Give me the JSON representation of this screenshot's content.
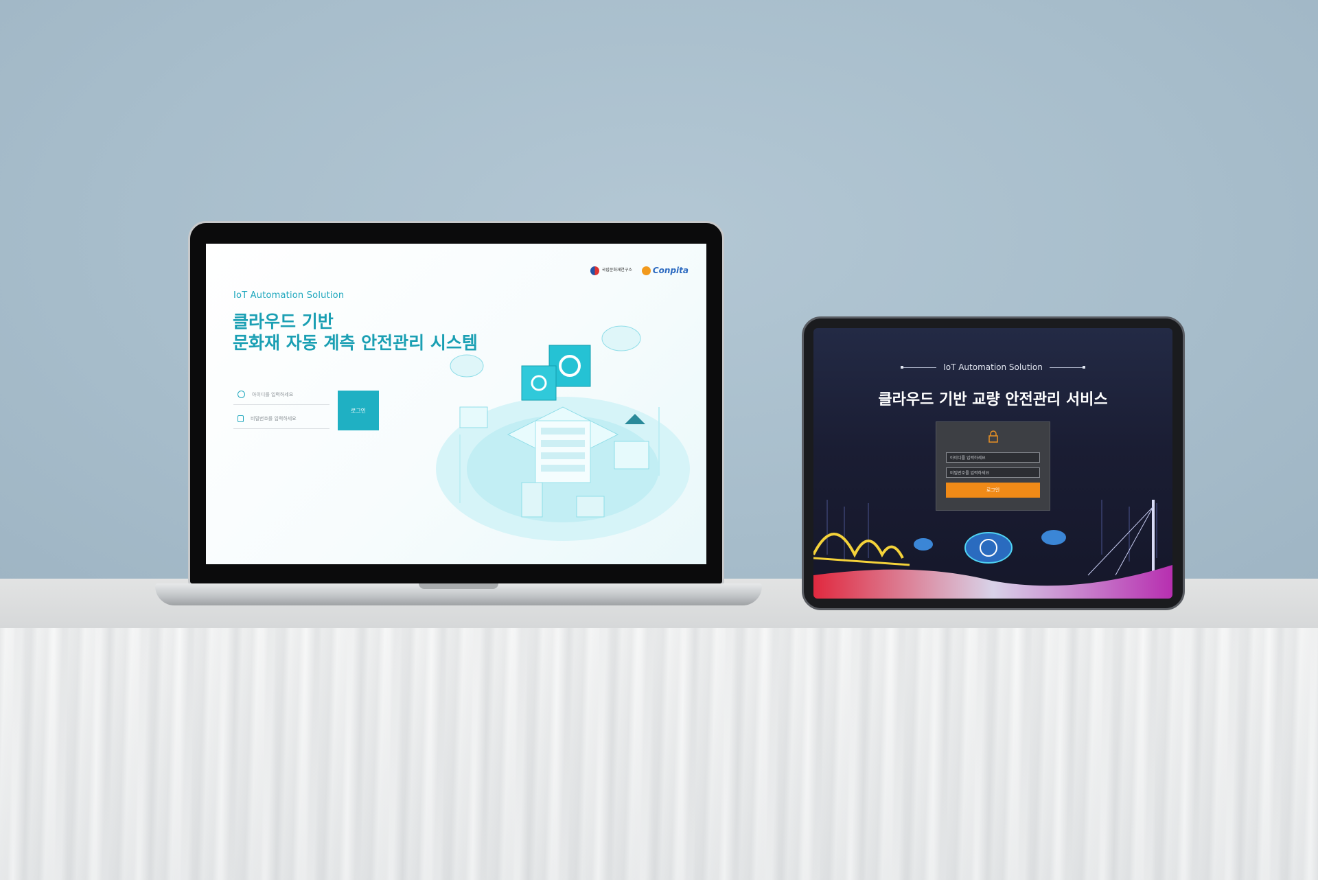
{
  "laptop_page": {
    "subtitle": "IoT Automation Solution",
    "title_line1": "클라우드 기반",
    "title_line2": "문화재 자동 계측 안전관리 시스템",
    "id_placeholder": "아이디를 입력하세요",
    "pw_placeholder": "비밀번호를 입력하세요",
    "login_label": "로그인",
    "logo_org_badge": "",
    "logo_org_name": "국립문화재연구소",
    "logo_brand": "Conpita",
    "accent": "#1ea7bd"
  },
  "tablet_page": {
    "subtitle": "IoT Automation Solution",
    "title": "클라우드 기반 교량 안전관리 서비스",
    "id_placeholder": "아이디를 입력하세요",
    "pw_placeholder": "비밀번호를 입력하세요",
    "login_label": "로그인",
    "accent": "#f08a17"
  }
}
